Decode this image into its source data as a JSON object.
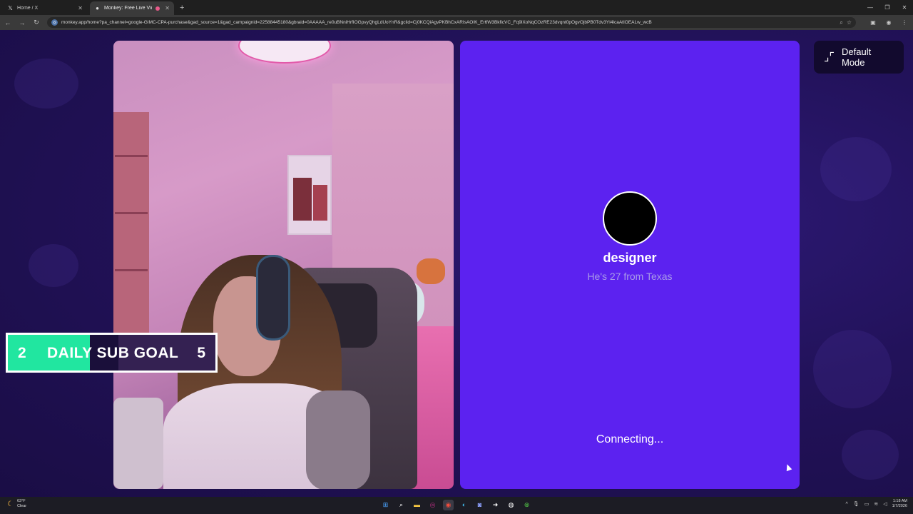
{
  "browser": {
    "tabs": [
      {
        "title": "Home / X",
        "icon": "x-logo-icon",
        "active": false
      },
      {
        "title": "Monkey: Free Live Video Ch...",
        "icon": "monkey-favicon-icon",
        "active": true
      }
    ],
    "new_tab": "+",
    "url": "monkey.app/home?pa_channel=google-GIMC-CPA-purchase&gad_source=1&gad_campaignid=22588445180&gbraid=0AAAAA_re0uBNniHrfIOGpvyQhgLdUoYnR&gclid=Cj0KCQiAgvPKBhCxARIsAOIK_Er6W3BkficVC_Fq9lXoNqCOzRE23dvqnt0pOgvOjbPB0Tdv3YI4lcaAtIOEALw_wcB"
  },
  "main": {
    "partner": {
      "username": "designer",
      "bio": "He's 27 from Texas",
      "status": "Connecting..."
    },
    "mode_button": {
      "label": "Default Mode",
      "icon": "collapse-icon"
    }
  },
  "overlay": {
    "goal_start": "2",
    "goal_label": "DAILY SUB GOAL",
    "goal_end": "5",
    "fill_color": "#21e6a0"
  },
  "taskbar": {
    "weather_temp": "63°F",
    "weather_cond": "Clear",
    "time": "1:18 AM",
    "date": "1/7/2026"
  },
  "colors": {
    "panel": "#5c22f0",
    "background": "#22125a"
  }
}
